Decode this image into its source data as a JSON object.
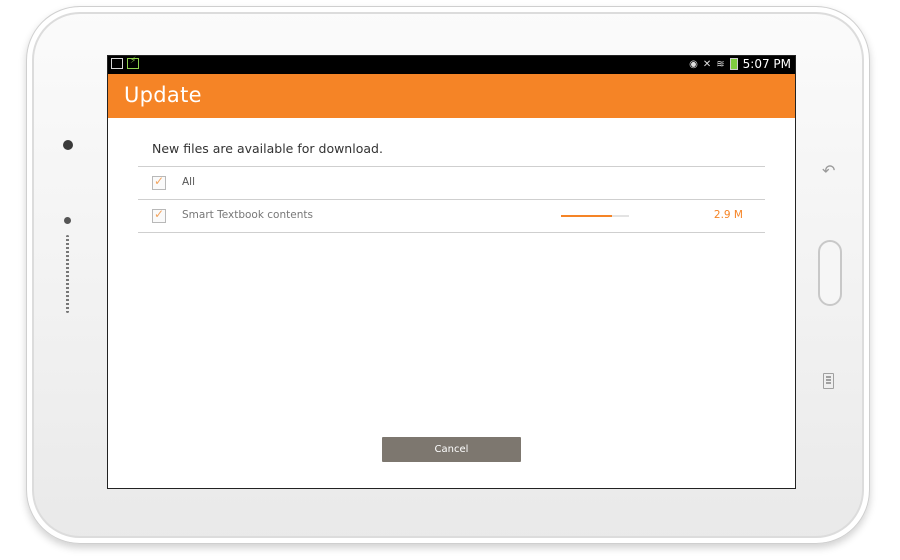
{
  "status_bar": {
    "time": "5:07 PM",
    "left_icons": [
      "image-icon",
      "charging-icon"
    ],
    "right_icons": [
      "eye-icon",
      "mute-icon",
      "wifi-icon",
      "battery-icon"
    ],
    "battery_color": "#7fcc3f"
  },
  "header": {
    "title": "Update",
    "accent_color": "#f58426"
  },
  "dialog": {
    "message": "New files are available for download.",
    "rows": [
      {
        "label": "All",
        "checked": true
      },
      {
        "label": "Smart Textbook contents",
        "checked": true,
        "progress": 0.75,
        "size": "2.9 M"
      }
    ],
    "cancel_label": "Cancel"
  }
}
